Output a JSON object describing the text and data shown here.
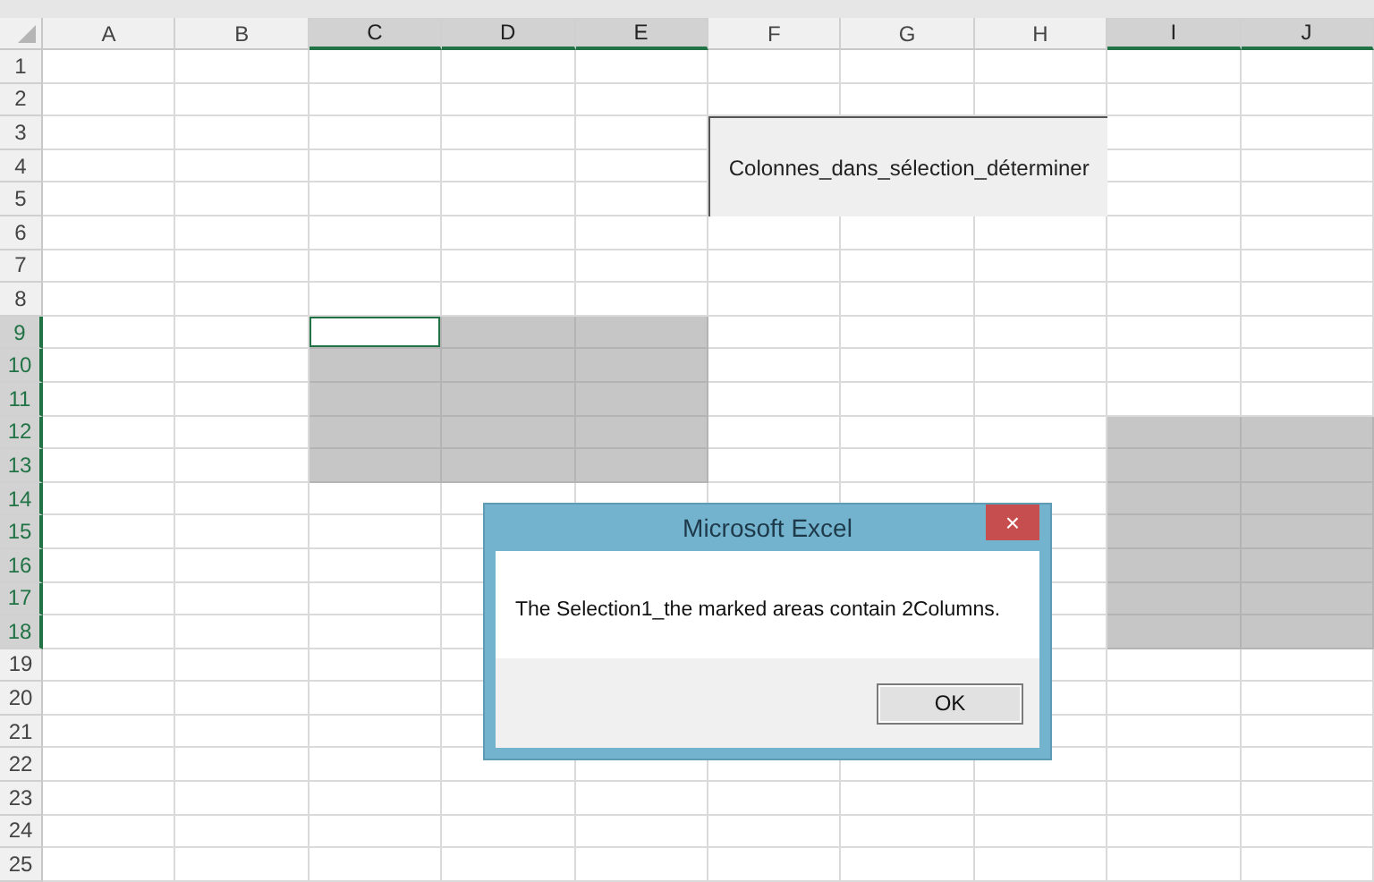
{
  "columns": [
    {
      "label": "A",
      "selected": false
    },
    {
      "label": "B",
      "selected": false
    },
    {
      "label": "C",
      "selected": true
    },
    {
      "label": "D",
      "selected": true
    },
    {
      "label": "E",
      "selected": true
    },
    {
      "label": "F",
      "selected": false
    },
    {
      "label": "G",
      "selected": false
    },
    {
      "label": "H",
      "selected": false
    },
    {
      "label": "I",
      "selected": true
    },
    {
      "label": "J",
      "selected": true
    }
  ],
  "rows": [
    {
      "label": "1",
      "selected": false,
      "selected_cells": [
        false,
        false,
        false,
        false,
        false,
        false,
        false,
        false,
        false,
        false
      ]
    },
    {
      "label": "2",
      "selected": false,
      "selected_cells": [
        false,
        false,
        false,
        false,
        false,
        false,
        false,
        false,
        false,
        false
      ]
    },
    {
      "label": "3",
      "selected": false,
      "selected_cells": [
        false,
        false,
        false,
        false,
        false,
        null,
        null,
        null,
        false,
        false
      ]
    },
    {
      "label": "4",
      "selected": false,
      "selected_cells": [
        false,
        false,
        false,
        false,
        false,
        null,
        null,
        null,
        false,
        false
      ]
    },
    {
      "label": "5",
      "selected": false,
      "selected_cells": [
        false,
        false,
        false,
        false,
        false,
        null,
        null,
        null,
        false,
        false
      ]
    },
    {
      "label": "6",
      "selected": false,
      "selected_cells": [
        false,
        false,
        false,
        false,
        false,
        false,
        false,
        false,
        false,
        false
      ]
    },
    {
      "label": "7",
      "selected": false,
      "selected_cells": [
        false,
        false,
        false,
        false,
        false,
        false,
        false,
        false,
        false,
        false
      ]
    },
    {
      "label": "8",
      "selected": false,
      "selected_cells": [
        false,
        false,
        false,
        false,
        false,
        false,
        false,
        false,
        false,
        false
      ]
    },
    {
      "label": "9",
      "selected": true,
      "selected_cells": [
        false,
        false,
        true,
        true,
        true,
        false,
        false,
        false,
        false,
        false
      ],
      "active_cells": [
        false,
        false,
        true,
        false,
        false,
        false,
        false,
        false,
        false,
        false
      ]
    },
    {
      "label": "10",
      "selected": true,
      "selected_cells": [
        false,
        false,
        true,
        true,
        true,
        false,
        false,
        false,
        false,
        false
      ]
    },
    {
      "label": "11",
      "selected": true,
      "selected_cells": [
        false,
        false,
        true,
        true,
        true,
        false,
        false,
        false,
        false,
        false
      ]
    },
    {
      "label": "12",
      "selected": true,
      "selected_cells": [
        false,
        false,
        true,
        true,
        true,
        false,
        false,
        false,
        true,
        true
      ]
    },
    {
      "label": "13",
      "selected": true,
      "selected_cells": [
        false,
        false,
        true,
        true,
        true,
        false,
        false,
        false,
        true,
        true
      ]
    },
    {
      "label": "14",
      "selected": true,
      "selected_cells": [
        false,
        false,
        false,
        false,
        false,
        false,
        false,
        false,
        true,
        true
      ]
    },
    {
      "label": "15",
      "selected": true,
      "selected_cells": [
        false,
        false,
        false,
        false,
        null,
        null,
        null,
        false,
        true,
        true
      ]
    },
    {
      "label": "16",
      "selected": true,
      "selected_cells": [
        false,
        false,
        false,
        false,
        null,
        null,
        null,
        false,
        true,
        true
      ]
    },
    {
      "label": "17",
      "selected": true,
      "selected_cells": [
        false,
        false,
        false,
        false,
        null,
        null,
        null,
        false,
        true,
        true
      ]
    },
    {
      "label": "18",
      "selected": true,
      "selected_cells": [
        false,
        false,
        false,
        false,
        null,
        null,
        null,
        false,
        true,
        true
      ]
    },
    {
      "label": "19",
      "selected": false,
      "selected_cells": [
        false,
        false,
        false,
        false,
        null,
        null,
        null,
        false,
        false,
        false
      ]
    },
    {
      "label": "20",
      "selected": false,
      "selected_cells": [
        false,
        false,
        false,
        false,
        null,
        null,
        null,
        false,
        false,
        false
      ]
    },
    {
      "label": "21",
      "selected": false,
      "selected_cells": [
        false,
        false,
        false,
        false,
        null,
        null,
        null,
        false,
        false,
        false
      ]
    },
    {
      "label": "22",
      "selected": false,
      "selected_cells": [
        false,
        false,
        false,
        false,
        false,
        false,
        false,
        false,
        false,
        false
      ]
    },
    {
      "label": "23",
      "selected": false,
      "selected_cells": [
        false,
        false,
        false,
        false,
        false,
        false,
        false,
        false,
        false,
        false
      ]
    },
    {
      "label": "24",
      "selected": false,
      "selected_cells": [
        false,
        false,
        false,
        false,
        false,
        false,
        false,
        false,
        false,
        false
      ]
    },
    {
      "label": "25",
      "selected": false,
      "selected_cells": [
        false,
        false,
        false,
        false,
        false,
        false,
        false,
        false,
        false,
        false
      ]
    }
  ],
  "macro_button": {
    "label": "Colonnes_dans_sélection_déterminer"
  },
  "dialog": {
    "title": "Microsoft Excel",
    "close": "×",
    "message": "The Selection1_the marked areas contain 2Columns.",
    "buttons": [
      "OK"
    ]
  }
}
